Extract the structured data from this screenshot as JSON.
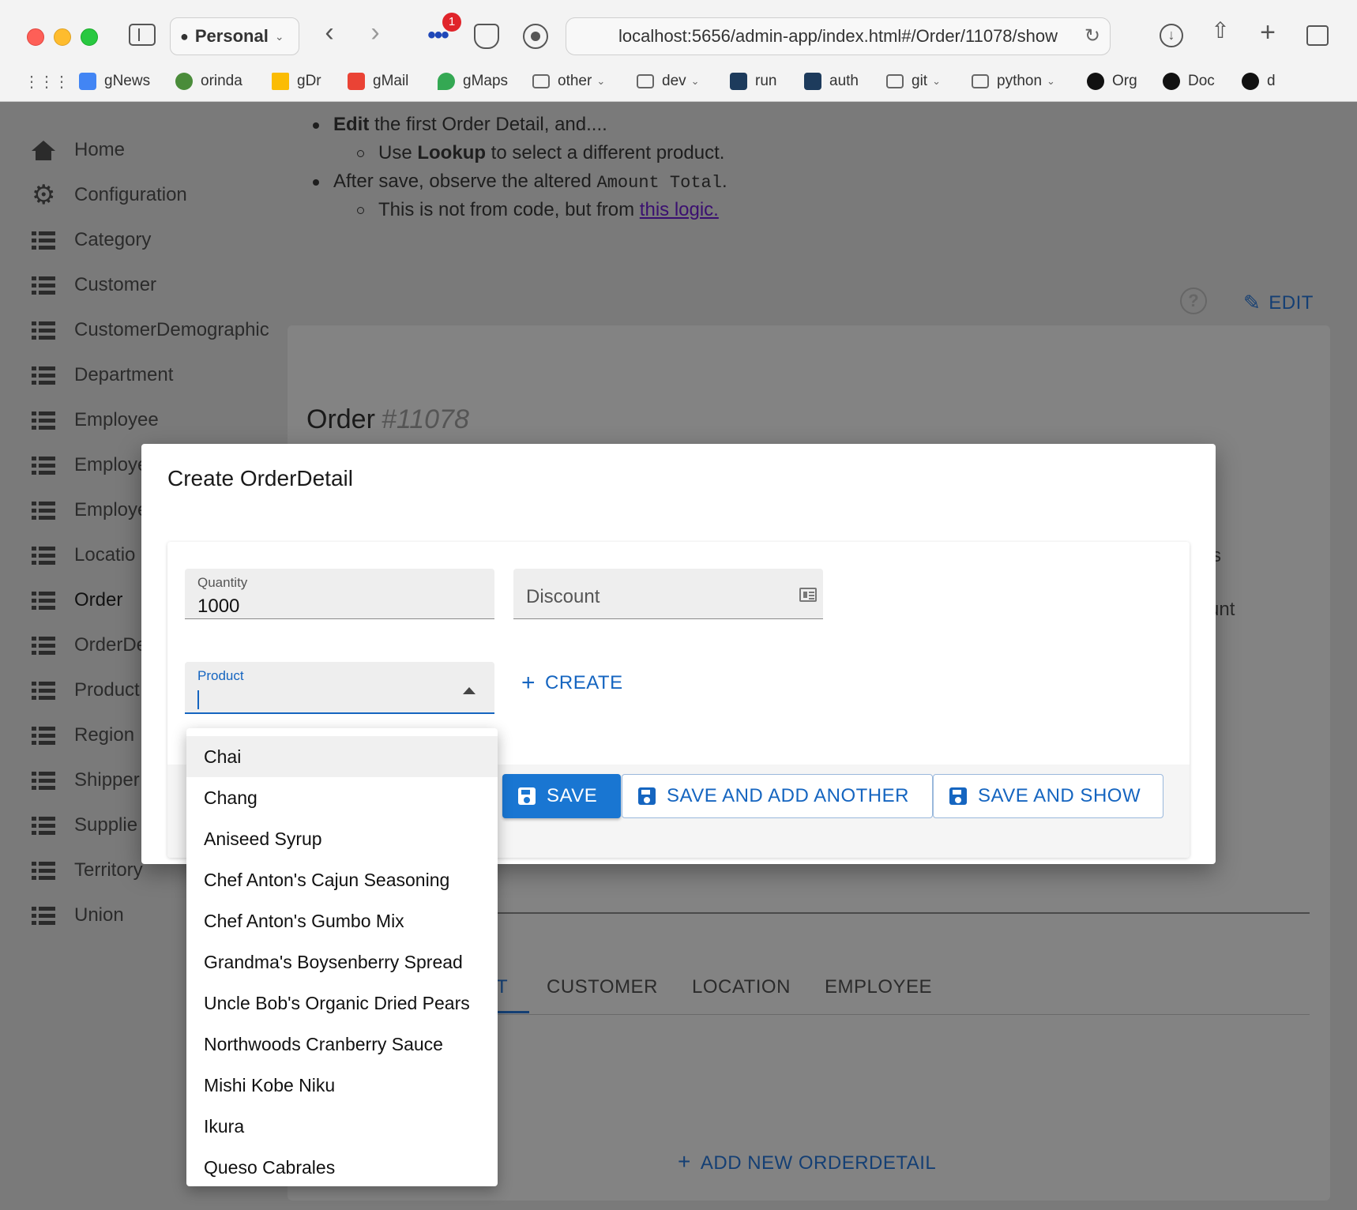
{
  "browser": {
    "profile_label": "Personal",
    "url": "localhost:5656/admin-app/index.html#/Order/11078/show",
    "extension_badge": "1",
    "bookmarks": [
      {
        "label": "gNews",
        "color": "#4285f4"
      },
      {
        "label": "orinda",
        "color": "#4a8c3a"
      },
      {
        "label": "gDr",
        "color": "#fbbc04"
      },
      {
        "label": "gMail",
        "color": "#ea4335"
      },
      {
        "label": "gMaps",
        "color": "#34a853"
      },
      {
        "label": "other",
        "folder": true
      },
      {
        "label": "dev",
        "folder": true
      },
      {
        "label": "run",
        "color": "#1d3b5c"
      },
      {
        "label": "auth",
        "color": "#1d3b5c"
      },
      {
        "label": "git",
        "folder": true
      },
      {
        "label": "python",
        "folder": true
      },
      {
        "label": "Org",
        "color": "#111111"
      },
      {
        "label": "Doc",
        "color": "#111111"
      },
      {
        "label": "d",
        "color": "#111111"
      }
    ]
  },
  "sidebar": {
    "items": [
      {
        "label": "Home",
        "icon": "home-icon"
      },
      {
        "label": "Configuration",
        "icon": "gear-icon"
      },
      {
        "label": "Category",
        "icon": "list-icon"
      },
      {
        "label": "Customer",
        "icon": "list-icon"
      },
      {
        "label": "CustomerDemographic",
        "icon": "list-icon"
      },
      {
        "label": "Department",
        "icon": "list-icon"
      },
      {
        "label": "Employee",
        "icon": "list-icon"
      },
      {
        "label": "Employe",
        "icon": "list-icon"
      },
      {
        "label": "Employe",
        "icon": "list-icon"
      },
      {
        "label": "Locatio",
        "icon": "list-icon"
      },
      {
        "label": "Order",
        "icon": "list-icon"
      },
      {
        "label": "OrderDe",
        "icon": "list-icon"
      },
      {
        "label": "Product",
        "icon": "list-icon"
      },
      {
        "label": "Region",
        "icon": "list-icon"
      },
      {
        "label": "Shipper",
        "icon": "list-icon"
      },
      {
        "label": "Supplie",
        "icon": "list-icon"
      },
      {
        "label": "Territory",
        "icon": "list-icon"
      },
      {
        "label": "Union",
        "icon": "list-icon"
      }
    ]
  },
  "instructions": {
    "line1_bold": "Edit",
    "line1_rest": " the first Order Detail, and....",
    "line2_pre": "Use ",
    "line2_bold": "Lookup",
    "line2_rest": " to select a different product.",
    "line3_pre": "After save, observe the altered ",
    "line3_code": "Amount Total",
    "line3_post": ".",
    "line4_pre": "This is not from code, but from ",
    "line4_link": "this logic."
  },
  "order": {
    "edit_label": "EDIT",
    "title": "Order",
    "number": "#11078",
    "ghost_s": "s",
    "ghost_unt": "unt",
    "tabs": [
      "T",
      "CUSTOMER",
      "LOCATION",
      "EMPLOYEE"
    ],
    "add_new_label": "ADD NEW ORDERDETAIL"
  },
  "modal": {
    "title": "Create OrderDetail",
    "quantity_label": "Quantity",
    "quantity_value": "1000",
    "discount_placeholder": "Discount",
    "product_label": "Product",
    "create_label": "CREATE",
    "save_label": "SAVE",
    "save_add_label": "SAVE AND ADD ANOTHER",
    "save_show_label": "SAVE AND SHOW"
  },
  "dropdown": {
    "options": [
      "Chai",
      "Chang",
      "Aniseed Syrup",
      "Chef Anton's Cajun Seasoning",
      "Chef Anton's Gumbo Mix",
      "Grandma's Boysenberry Spread",
      "Uncle Bob's Organic Dried Pears",
      "Northwoods Cranberry Sauce",
      "Mishi Kobe Niku",
      "Ikura",
      "Queso Cabrales"
    ],
    "highlighted": "Chai"
  },
  "colors": {
    "primary": "#1976d2",
    "link": "#1565c0",
    "overlay": "#7a7a7a"
  }
}
